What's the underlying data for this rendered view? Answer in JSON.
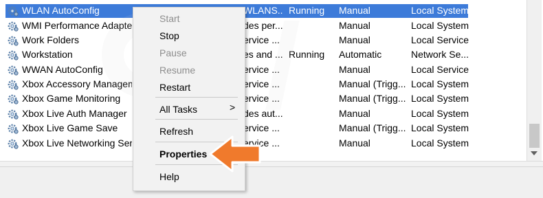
{
  "services": [
    {
      "name": "WLAN AutoConfig",
      "desc": "WLANS...",
      "status": "Running",
      "startup": "Manual",
      "logon": "Local System",
      "selected": true
    },
    {
      "name": "WMI Performance Adapter",
      "desc": "des per...",
      "status": "",
      "startup": "Manual",
      "logon": "Local System"
    },
    {
      "name": "Work Folders",
      "desc": "ervice ...",
      "status": "",
      "startup": "Manual",
      "logon": "Local Service"
    },
    {
      "name": "Workstation",
      "desc": "es and ...",
      "status": "Running",
      "startup": "Automatic",
      "logon": "Network Se..."
    },
    {
      "name": "WWAN AutoConfig",
      "desc": "ervice ...",
      "status": "",
      "startup": "Manual",
      "logon": "Local Service"
    },
    {
      "name": "Xbox Accessory Manageme",
      "desc": "ervice ...",
      "status": "",
      "startup": "Manual (Trigg...",
      "logon": "Local System"
    },
    {
      "name": "Xbox Game Monitoring",
      "desc": "ervice ...",
      "status": "",
      "startup": "Manual (Trigg...",
      "logon": "Local System"
    },
    {
      "name": "Xbox Live Auth Manager",
      "desc": "des aut...",
      "status": "",
      "startup": "Manual",
      "logon": "Local System"
    },
    {
      "name": "Xbox Live Game Save",
      "desc": "ervice ...",
      "status": "",
      "startup": "Manual (Trigg...",
      "logon": "Local System"
    },
    {
      "name": "Xbox Live Networking Servi",
      "desc": "ervice ...",
      "status": "",
      "startup": "Manual",
      "logon": "Local System"
    }
  ],
  "context_menu": {
    "start": "Start",
    "stop": "Stop",
    "pause": "Pause",
    "resume": "Resume",
    "restart": "Restart",
    "all_tasks": "All Tasks",
    "all_tasks_arrow": ">",
    "refresh": "Refresh",
    "properties": "Properties",
    "help": "Help"
  },
  "colors": {
    "selection": "#3d7bd9",
    "callout": "#f07a2c"
  },
  "icons": {
    "service": "gear-icon",
    "callout": "arrow-left-icon"
  }
}
